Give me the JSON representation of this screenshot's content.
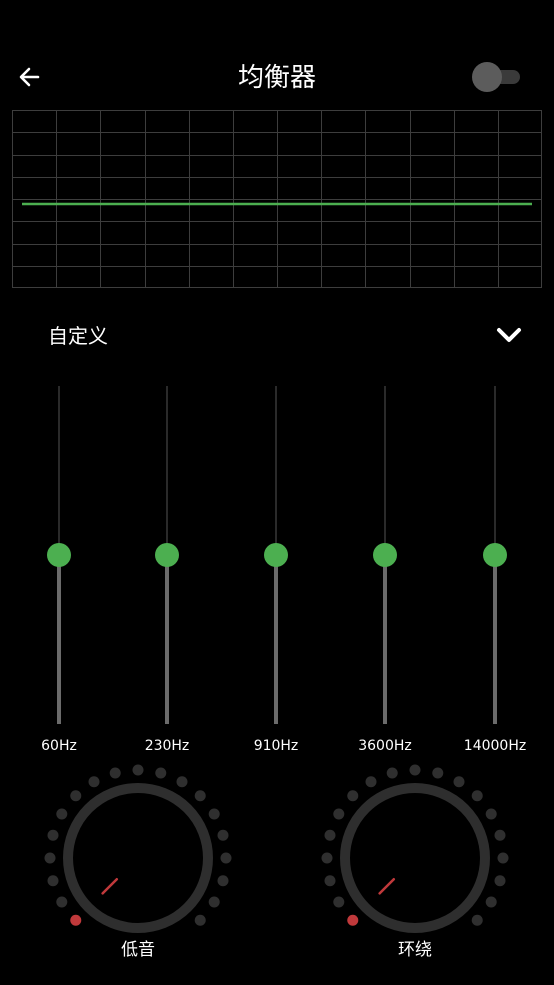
{
  "header": {
    "title": "均衡器",
    "toggle_on": false
  },
  "eq_curve": {
    "color": "#4caf50",
    "gain_level": 0.5
  },
  "preset": {
    "label": "自定义"
  },
  "bands": [
    {
      "freq": "60Hz",
      "level": 0.5
    },
    {
      "freq": "230Hz",
      "level": 0.5
    },
    {
      "freq": "910Hz",
      "level": 0.5
    },
    {
      "freq": "3600Hz",
      "level": 0.5
    },
    {
      "freq": "14000Hz",
      "level": 0.5
    }
  ],
  "knobs": [
    {
      "label": "低音",
      "level": 0
    },
    {
      "label": "环绕",
      "level": 0
    }
  ],
  "colors": {
    "accent": "#4caf50",
    "knob_indicator": "#c0393b",
    "dot_inactive": "#2f2f2f",
    "background": "#000000"
  },
  "icons": {
    "back": "arrow-left-icon",
    "dropdown": "chevron-down-icon"
  }
}
